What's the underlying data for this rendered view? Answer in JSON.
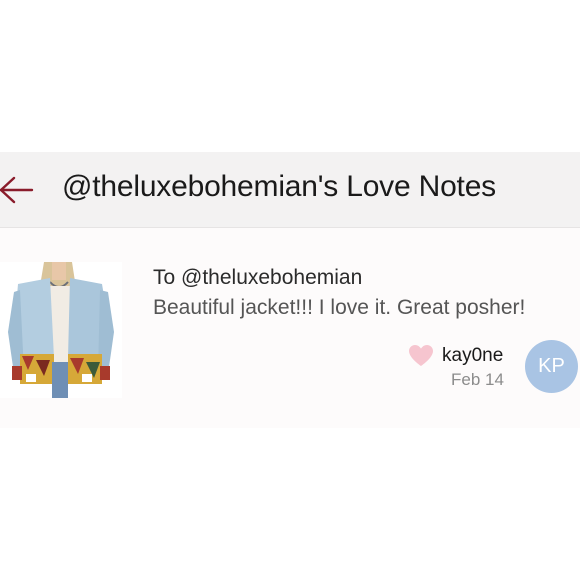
{
  "header": {
    "title": "@theluxebohemian's Love Notes",
    "back_icon": "back-arrow-icon",
    "accent_color": "#8a1c2b"
  },
  "note": {
    "to_line": "To @theluxebohemian",
    "message": "Beautiful jacket!!! I love it. Great posher!",
    "author": "kay0ne",
    "date": "Feb 14",
    "avatar_initials": "KP",
    "avatar_color": "#a9c4e4",
    "like_icon": "heart-icon",
    "like_color": "#f6c5cf"
  }
}
